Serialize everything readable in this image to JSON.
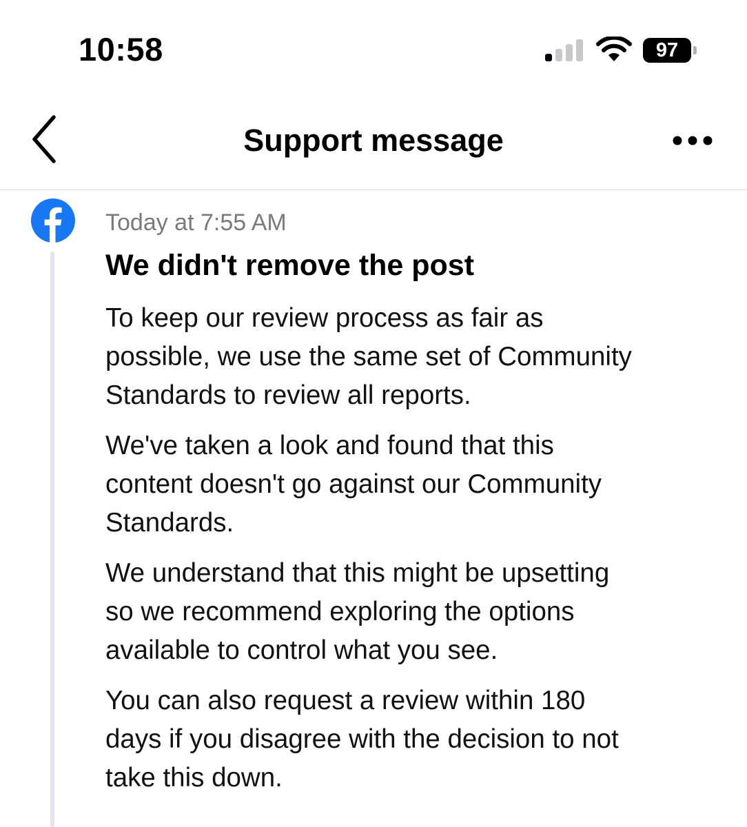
{
  "status_bar": {
    "time": "10:58",
    "battery_level": "97",
    "signal_bars": 1,
    "signal_bars_total": 4
  },
  "nav": {
    "title": "Support message",
    "back_icon": "chevron-left-icon",
    "more_icon": "more-horizontal-icon"
  },
  "message": {
    "sender_icon": "facebook-logo",
    "timestamp": "Today at 7:55 AM",
    "title": "We didn't remove the post",
    "paragraphs": [
      {
        "lines": [
          "To keep our review process as fair as",
          "possible, we use the same set of Community",
          "Standards to review all reports."
        ]
      },
      {
        "lines": [
          "We've taken a look and found that this",
          "content doesn't go against our Community",
          "Standards."
        ]
      },
      {
        "lines": [
          "We understand that this might be upsetting",
          "so we recommend exploring the options",
          "available to control what you see."
        ]
      },
      {
        "lines": [
          "You can also request a review within 180",
          "days if you disagree with the decision to not",
          "take this down."
        ]
      }
    ]
  },
  "colors": {
    "facebook_blue": "#1877F2",
    "timestamp_gray": "#7A7A7A",
    "thread_line": "#E4E4EC",
    "signal_inactive": "#C7C7CC"
  }
}
